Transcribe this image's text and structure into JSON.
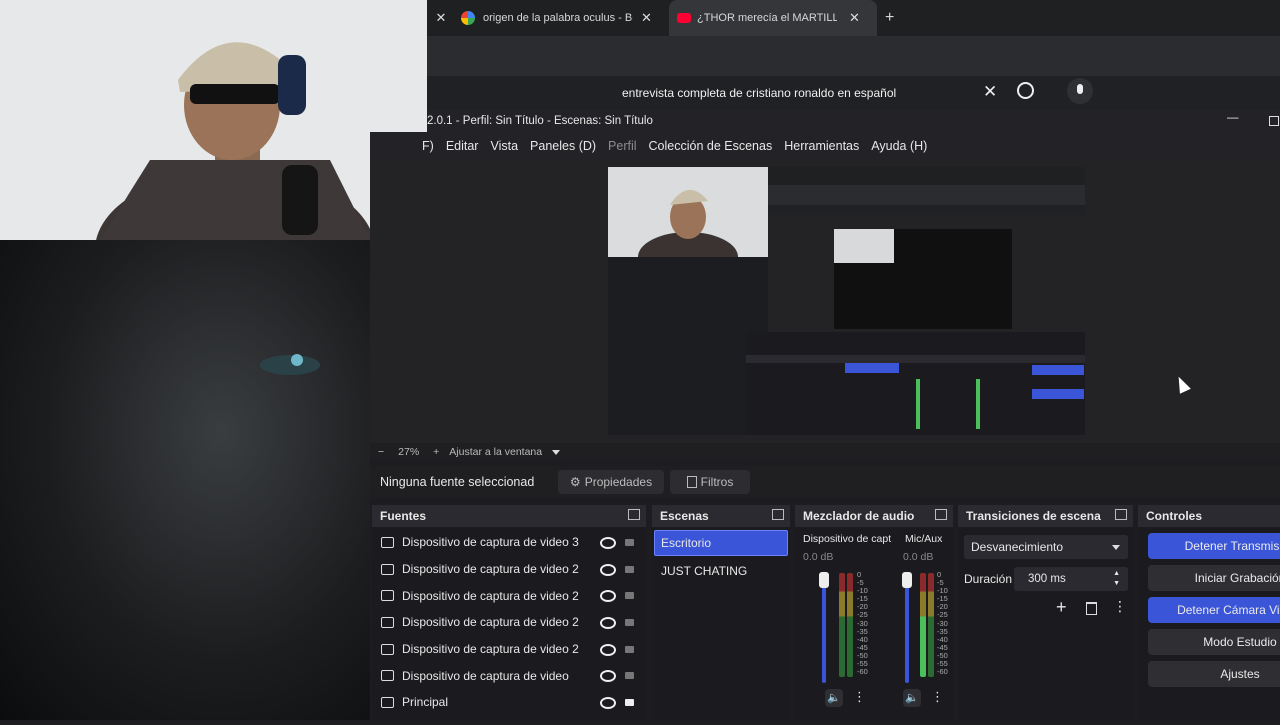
{
  "browser": {
    "tabs": [
      {
        "title": "origen de la palabra oculus - Bu"
      },
      {
        "title": "¿THOR merecía el MARTILLO..."
      }
    ],
    "search_query": "entrevista completa de cristiano ronaldo en español"
  },
  "obs": {
    "title": "2.0.1 - Perfil: Sin Título - Escenas: Sin Título",
    "menu": [
      {
        "label": "F)"
      },
      {
        "label": "Editar"
      },
      {
        "label": "Vista"
      },
      {
        "label": "Paneles (D)"
      },
      {
        "label": "Perfil"
      },
      {
        "label": "Colección de Escenas"
      },
      {
        "label": "Herramientas"
      },
      {
        "label": "Ayuda (H)"
      }
    ],
    "zoom": {
      "minus": "−",
      "value": "27%",
      "plus": "+",
      "fit_label": "Ajustar a la ventana"
    },
    "source_toolbar": {
      "no_selection": "Ninguna fuente seleccionad",
      "properties": "Propiedades",
      "filters": "Filtros"
    },
    "sources": {
      "title": "Fuentes",
      "items": [
        {
          "label": "Dispositivo de captura de video 3",
          "icon": "camera-icon",
          "locked": false
        },
        {
          "label": "Dispositivo de captura de video 2",
          "icon": "camera-icon",
          "locked": false
        },
        {
          "label": "Dispositivo de captura de video 2",
          "icon": "camera-icon",
          "locked": false
        },
        {
          "label": "Dispositivo de captura de video 2",
          "icon": "camera-icon",
          "locked": false
        },
        {
          "label": "Dispositivo de captura de video 2",
          "icon": "camera-icon",
          "locked": false
        },
        {
          "label": "Dispositivo de captura de video",
          "icon": "camera-icon",
          "locked": false
        },
        {
          "label": "Principal",
          "icon": "monitor-icon",
          "locked": true
        }
      ]
    },
    "scenes": {
      "title": "Escenas",
      "items": [
        {
          "label": "Escritorio",
          "selected": true
        },
        {
          "label": "JUST CHATING",
          "selected": false
        }
      ]
    },
    "mixer": {
      "title": "Mezclador de audio",
      "channels": [
        {
          "name": "Dispositivo de capt",
          "db": "0.0 dB"
        },
        {
          "name": "Mic/Aux",
          "db": "0.0 dB"
        }
      ],
      "scale": [
        "0",
        "-5",
        "-10",
        "-15",
        "-20",
        "-25",
        "-30",
        "-35",
        "-40",
        "-45",
        "-50",
        "-55",
        "-60"
      ]
    },
    "transitions": {
      "title": "Transiciones de escena",
      "selected": "Desvanecimiento",
      "duration_label": "Duración",
      "duration_value": "300 ms"
    },
    "controls": {
      "title": "Controles",
      "buttons": [
        {
          "label": "Detener Transmisión",
          "style": "blue"
        },
        {
          "label": "Iniciar Grabación",
          "style": "normal"
        },
        {
          "label": "Detener Cámara Virtual",
          "style": "blue"
        },
        {
          "label": "Modo Estudio",
          "style": "normal"
        },
        {
          "label": "Ajustes",
          "style": "normal"
        }
      ]
    }
  },
  "colors": {
    "accent": "#3a55d8",
    "panel": "#1b1b1f",
    "header": "#2a2a30"
  }
}
